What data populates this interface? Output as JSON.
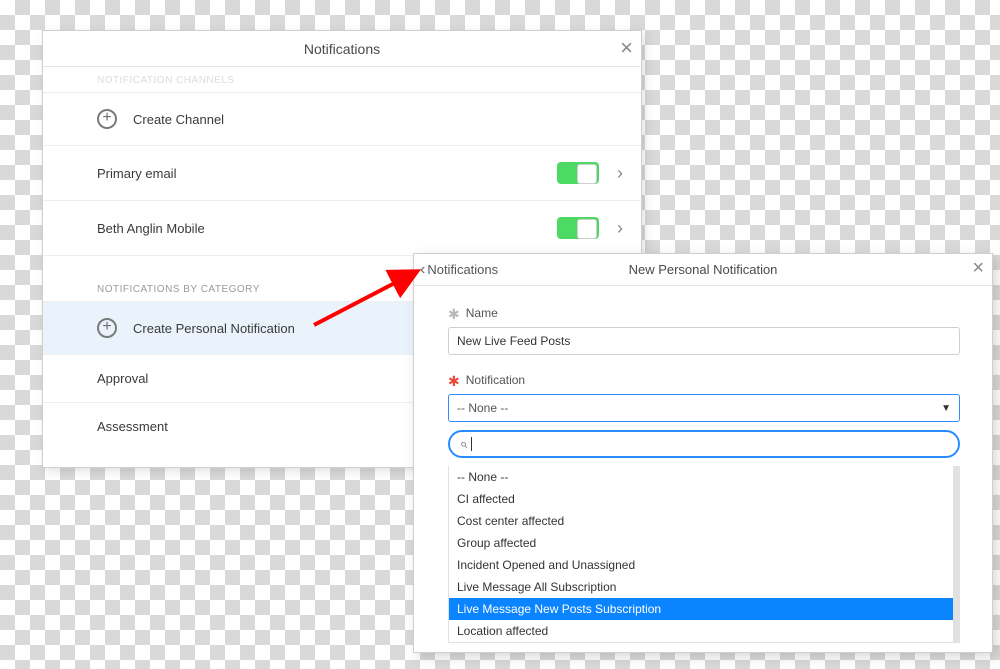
{
  "panel1": {
    "title": "Notifications",
    "section_channels_title": "NOTIFICATION CHANNELS",
    "create_channel": "Create Channel",
    "channels": [
      {
        "label": "Primary email",
        "on": true
      },
      {
        "label": "Beth Anglin Mobile",
        "on": true
      }
    ],
    "section_categories_title": "NOTIFICATIONS BY CATEGORY",
    "create_personal": "Create Personal Notification",
    "categories": [
      "Approval",
      "Assessment"
    ]
  },
  "panel2": {
    "back_label": "Notifications",
    "title": "New Personal Notification",
    "name_label": "Name",
    "name_value": "New Live Feed Posts",
    "notification_label": "Notification",
    "notification_value": "-- None --",
    "search_value": "",
    "options": [
      "-- None --",
      "CI affected",
      "Cost center affected",
      "Group affected",
      "Incident Opened and Unassigned",
      "Live Message All Subscription",
      "Live Message New Posts Subscription",
      "Location affected"
    ],
    "selected_option_index": 6
  }
}
